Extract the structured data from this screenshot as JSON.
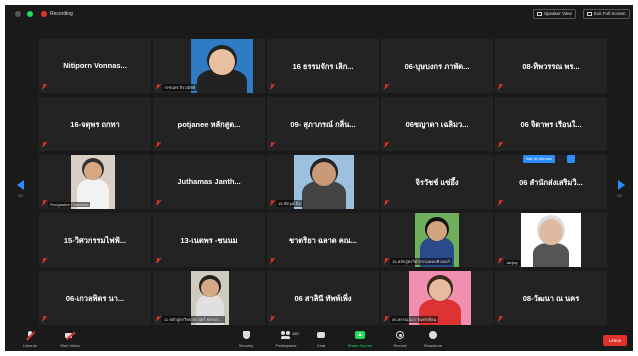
{
  "topbar": {
    "recording_label": "Recording",
    "speaker_view_label": "Speaker View",
    "exit_fullscreen_label": "Exit Full Screen"
  },
  "pager": {
    "left": "4/5",
    "right": "4/5"
  },
  "rename_label": "Ask to Unmute",
  "tiles": [
    {
      "name": "Nitiporn  Vonnas...",
      "sub": ""
    },
    {
      "name": "",
      "sub": "ารชนพร จิรวณิชย์"
    },
    {
      "name": "16 ธรรมจักร เลิก...",
      "sub": ""
    },
    {
      "name": "06-บุษบงกร ภาพัด...",
      "sub": ""
    },
    {
      "name": "08-ทิพวรรณ พร...",
      "sub": ""
    },
    {
      "name": "16-จตุพร ถกทา",
      "sub": ""
    },
    {
      "name": "potjanee หลักสูต...",
      "sub": ""
    },
    {
      "name": "09- สุภาภรณ์ กลิ่น...",
      "sub": ""
    },
    {
      "name": "06ชญาดา เฉลิมว...",
      "sub": ""
    },
    {
      "name": "06 จิตาพร เรือนใ...",
      "sub": ""
    },
    {
      "name": "",
      "sub": "Rungradee Dittavicha"
    },
    {
      "name": "Juthamas Janth...",
      "sub": ""
    },
    {
      "name": "",
      "sub": "15-ชัยวุฒิ อิ่ม"
    },
    {
      "name": "จิรวัชช์ แซ่อึ้ง",
      "sub": ""
    },
    {
      "name": "06 สำนักส่งเสริมวิ...",
      "sub": ""
    },
    {
      "name": "15-วิศวกรรมไฟฟ้...",
      "sub": ""
    },
    {
      "name": "13-เนตพร -ชนนม",
      "sub": ""
    },
    {
      "name": "ชาตริยา ฉลาด คณ...",
      "sub": ""
    },
    {
      "name": "",
      "sub": "15-หลักสูตรวิศวกรรมคอมพิวเตอร์"
    },
    {
      "name": "",
      "sub": "Janjay"
    },
    {
      "name": "06-เกวลพิตร นา...",
      "sub": ""
    },
    {
      "name": "",
      "sub": "11 หลักสูตรวิทยาศาสตร์ พรรณา..."
    },
    {
      "name": "06 สาลินี ทัพพ์เพิ่ง",
      "sub": ""
    },
    {
      "name": "",
      "sub": "06-พรรณนิภา จันทร์เขียน"
    },
    {
      "name": "08-วัฒนา ณ นคร",
      "sub": ""
    }
  ],
  "toolbar": {
    "unmute": "Unmute",
    "start_video": "Start Video",
    "security": "Security",
    "participants": "Participants",
    "participants_count": "150",
    "chat": "Chat",
    "share_screen": "Share Screen",
    "record": "Record",
    "reactions": "Reactions",
    "leave": "Leave"
  },
  "colors": {
    "accent": "#2d8cff",
    "danger": "#e0322b",
    "share": "#23d959",
    "tile_bg": "#232323",
    "window_bg": "#1a1a1a"
  }
}
